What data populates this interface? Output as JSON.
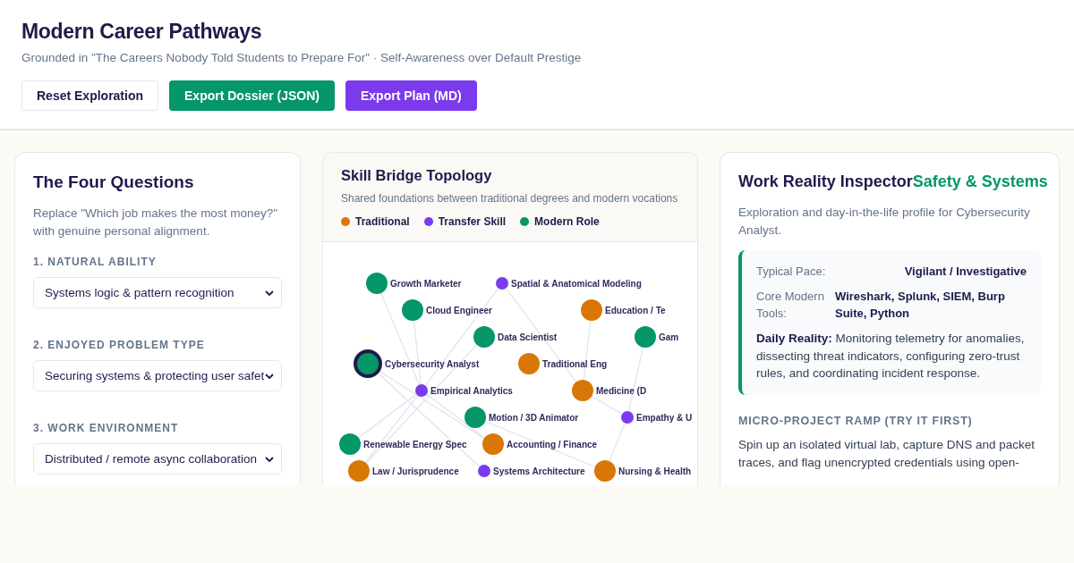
{
  "header": {
    "title": "Modern Career Pathways",
    "subtitle": "Grounded in \"The Careers Nobody Told Students to Prepare For\" · Self-Awareness over Default Prestige",
    "buttons": [
      {
        "label": "Reset Exploration",
        "kind": "plain"
      },
      {
        "label": "Export Dossier (JSON)",
        "kind": "green"
      },
      {
        "label": "Export Plan (MD)",
        "kind": "purple"
      }
    ]
  },
  "questions": {
    "title": "The Four Questions",
    "intro": "Replace \"Which job makes the most money?\" with genuine personal alignment.",
    "items": [
      {
        "label": "1. NATURAL ABILITY",
        "value": "Systems logic & pattern recognition"
      },
      {
        "label": "2. ENJOYED PROBLEM TYPE",
        "value": "Securing systems & protecting user safet"
      },
      {
        "label": "3. WORK ENVIRONMENT",
        "value": "Distributed / remote async collaboration"
      }
    ]
  },
  "topology": {
    "title": "Skill Bridge Topology",
    "subtitle": "Shared foundations between traditional degrees and modern vocations",
    "legend": [
      {
        "label": "Traditional",
        "kind": "traditional"
      },
      {
        "label": "Transfer Skill",
        "kind": "transfer"
      },
      {
        "label": "Modern Role",
        "kind": "modern"
      }
    ],
    "nodes": [
      {
        "label": "Growth Marketer",
        "kind": "modern",
        "selected": false
      },
      {
        "label": "Spatial & Anatomical Modeling",
        "kind": "transfer",
        "selected": false
      },
      {
        "label": "Cloud Engineer",
        "kind": "modern",
        "selected": false
      },
      {
        "label": "Education / Te",
        "kind": "traditional",
        "selected": false
      },
      {
        "label": "Data Scientist",
        "kind": "modern",
        "selected": false
      },
      {
        "label": "Gam",
        "kind": "modern",
        "selected": false
      },
      {
        "label": "Cybersecurity Analyst",
        "kind": "modern",
        "selected": true
      },
      {
        "label": "Traditional Eng",
        "kind": "traditional",
        "selected": false
      },
      {
        "label": "Empirical Analytics",
        "kind": "transfer",
        "selected": false
      },
      {
        "label": "Medicine (D",
        "kind": "traditional",
        "selected": false
      },
      {
        "label": "Motion / 3D Animator",
        "kind": "modern",
        "selected": false
      },
      {
        "label": "Empathy & U",
        "kind": "transfer",
        "selected": false
      },
      {
        "label": "Renewable Energy Spec",
        "kind": "modern",
        "selected": false
      },
      {
        "label": "Accounting / Finance",
        "kind": "traditional",
        "selected": false
      },
      {
        "label": "Law / Jurisprudence",
        "kind": "traditional",
        "selected": false
      },
      {
        "label": "Systems Architecture",
        "kind": "transfer",
        "selected": false
      },
      {
        "label": "Nursing & Health",
        "kind": "traditional",
        "selected": false
      }
    ]
  },
  "inspector": {
    "title": "Work Reality Inspector",
    "tag": "Safety & Systems",
    "intro": "Exploration and day-in-the-life profile for Cybersecurity Analyst.",
    "facts": [
      {
        "label": "Typical Pace:",
        "value": "Vigilant / Investigative"
      },
      {
        "label": "Core Modern Tools:",
        "value": "Wireshark, Splunk, SIEM, Burp Suite, Python"
      }
    ],
    "daily": "**Daily Reality:** Monitoring telemetry for anomalies, dissecting threat indicators, configuring zero-trust rules, and coordinating incident response.",
    "ramp_title": "MICRO-PROJECT RAMP (TRY IT FIRST)",
    "ramp_text": "Spin up an isolated virtual lab, capture DNS and packet traces, and flag unencrypted credentials using open-"
  }
}
